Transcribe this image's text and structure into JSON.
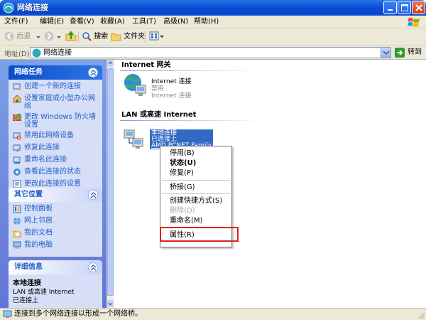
{
  "window": {
    "title": "网络连接"
  },
  "menu": {
    "items": [
      "文件(F)",
      "编辑(E)",
      "查看(V)",
      "收藏(A)",
      "工具(T)",
      "高级(N)",
      "帮助(H)"
    ]
  },
  "toolbar": {
    "back_label": "后退",
    "search_label": "搜索",
    "folders_label": "文件夹"
  },
  "address": {
    "label": "地址(D)",
    "value": "网络连接",
    "go_label": "转到"
  },
  "left_pane": {
    "network_tasks": {
      "title": "网络任务",
      "items": [
        {
          "label": "创建一个新的连接",
          "icon": "new-connection-icon"
        },
        {
          "label": "设置家庭或小型办公网络",
          "icon": "home-network-icon"
        },
        {
          "label": "更改 Windows 防火墙设置",
          "icon": "firewall-icon"
        },
        {
          "label": "禁用此网络设备",
          "icon": "disable-device-icon"
        },
        {
          "label": "修复此连接",
          "icon": "repair-icon"
        },
        {
          "label": "重命名此连接",
          "icon": "rename-icon"
        },
        {
          "label": "查看此连接的状态",
          "icon": "status-icon"
        },
        {
          "label": "更改此连接的设置",
          "icon": "settings-icon"
        }
      ]
    },
    "other_places": {
      "title": "其它位置",
      "items": [
        {
          "label": "控制面板",
          "icon": "control-panel-icon"
        },
        {
          "label": "网上邻居",
          "icon": "network-places-icon"
        },
        {
          "label": "我的文档",
          "icon": "documents-icon"
        },
        {
          "label": "我的电脑",
          "icon": "computer-icon"
        }
      ]
    },
    "details": {
      "title": "详细信息",
      "name": "本地连接",
      "type": "LAN 或高速 Internet",
      "status": "已连接上"
    }
  },
  "content": {
    "internet_gateway": {
      "section_title": "Internet 网关",
      "item_name": "Internet 连接",
      "item_status": "禁用",
      "item_type": "Internet 连接"
    },
    "lan": {
      "section_title": "LAN 或高速 Internet",
      "item_name": "本地连接",
      "item_status": "已连接上",
      "item_device": "AMD PCNET Family"
    }
  },
  "context_menu": {
    "items": {
      "disable": "停用(B)",
      "status": "状态(U)",
      "repair": "修复(P)",
      "bridge": "桥接(G)",
      "shortcut": "创建快捷方式(S)",
      "delete": "删除(D)",
      "rename": "重命名(M)",
      "properties": "属性(R)"
    },
    "highlight_color": "#e02020"
  },
  "statusbar": {
    "text": "连接到多个网络连接以形成一个网络桥。"
  },
  "colors": {
    "titlebar": "#0a4fd6",
    "selection": "#316ac5",
    "task_link": "#215dc6"
  }
}
